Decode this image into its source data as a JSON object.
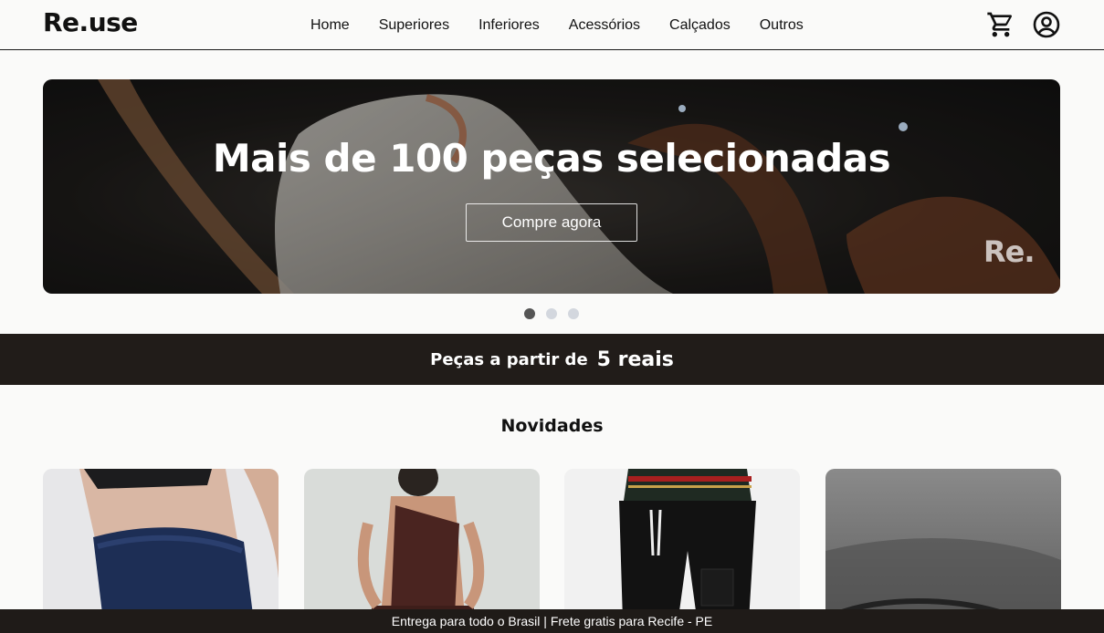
{
  "brand": {
    "logo": "Re.use"
  },
  "nav": {
    "items": [
      {
        "label": "Home"
      },
      {
        "label": "Superiores"
      },
      {
        "label": "Inferiores"
      },
      {
        "label": "Acessórios"
      },
      {
        "label": "Calçados"
      },
      {
        "label": "Outros"
      }
    ],
    "icons": [
      "cart-icon",
      "account-icon"
    ]
  },
  "hero": {
    "title": "Mais de 100 peças selecionadas",
    "cta_label": "Compre agora",
    "watermark": "Re.",
    "slides_total": 3,
    "active_slide": 1
  },
  "promo": {
    "prefix": "Peças a partir de",
    "highlight": "5 reais"
  },
  "section": {
    "title": "Novidades"
  },
  "products": [
    {
      "image": "navy-shorts-photo"
    },
    {
      "image": "brown-one-shoulder-dress-photo"
    },
    {
      "image": "black-cargo-pants-photo"
    },
    {
      "image": "gray-fabric-item-photo"
    }
  ],
  "footer": {
    "notice": "Entrega para todo o Brasil | Frete gratis para Recife - PE"
  },
  "colors": {
    "background": "#fafaf9",
    "dark_strip": "#211c19",
    "text": "#111111",
    "dot_inactive": "#d3d7de",
    "dot_active": "#555555"
  }
}
